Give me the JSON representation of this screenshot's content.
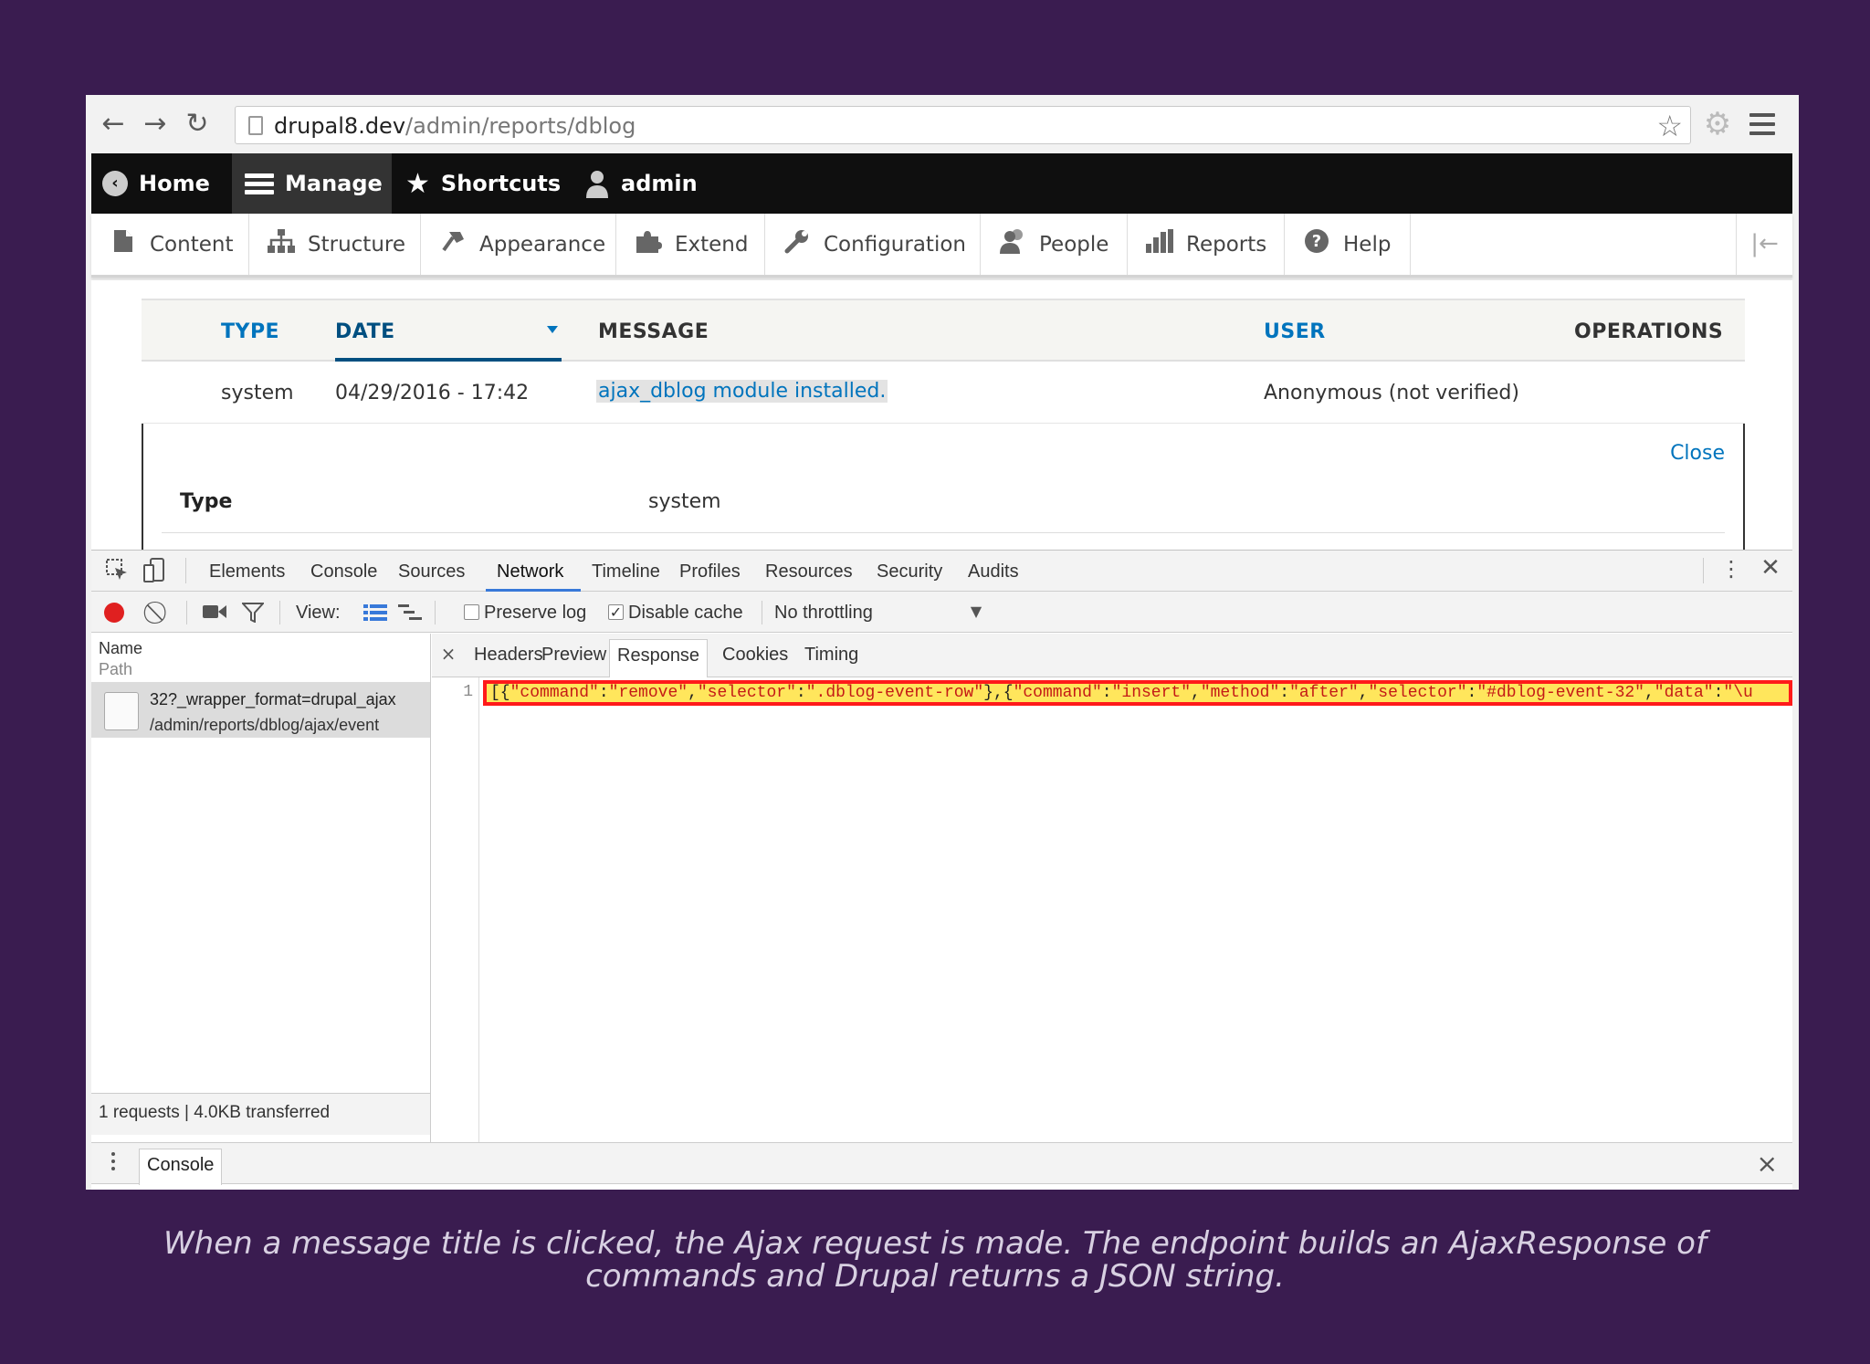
{
  "browser": {
    "url_host": "drupal8.dev",
    "url_path": "/admin/reports/dblog",
    "icons": {
      "back": "arrow-left",
      "forward": "arrow-right",
      "reload": "reload",
      "star": "star",
      "extension": "gear",
      "menu": "hamburger"
    }
  },
  "toolbar": {
    "home": "Home",
    "manage": "Manage",
    "shortcuts": "Shortcuts",
    "user": "admin",
    "tray": [
      "Content",
      "Structure",
      "Appearance",
      "Extend",
      "Configuration",
      "People",
      "Reports",
      "Help"
    ]
  },
  "dblog": {
    "headers": {
      "type": "TYPE",
      "date": "DATE",
      "message": "MESSAGE",
      "user": "USER",
      "operations": "OPERATIONS"
    },
    "row": {
      "type": "system",
      "date": "04/29/2016 - 17:42",
      "message": "ajax_dblog module installed.",
      "user": "Anonymous (not verified)"
    },
    "detail": {
      "close": "Close",
      "type_label": "Type",
      "type_value": "system"
    }
  },
  "devtools": {
    "tabs": [
      "Elements",
      "Console",
      "Sources",
      "Network",
      "Timeline",
      "Profiles",
      "Resources",
      "Security",
      "Audits"
    ],
    "active_tab": "Network",
    "network_toolbar": {
      "view_label": "View:",
      "preserve_log": "Preserve log",
      "preserve_log_checked": false,
      "disable_cache": "Disable cache",
      "disable_cache_checked": true,
      "throttling": "No throttling"
    },
    "requests_header": {
      "name": "Name",
      "path": "Path"
    },
    "request": {
      "name": "32?_wrapper_format=drupal_ajax",
      "path": "/admin/reports/dblog/ajax/event"
    },
    "status": "1 requests | 4.0KB transferred",
    "detail_tabs": [
      "Headers",
      "Preview",
      "Response",
      "Cookies",
      "Timing"
    ],
    "active_detail_tab": "Response",
    "response_line_number": "1",
    "response_json": "[{\"command\":\"remove\",\"selector\":\".dblog-event-row\"},{\"command\":\"insert\",\"method\":\"after\",\"selector\":\"#dblog-event-32\",\"data\":\"\\u",
    "drawer_tab": "Console"
  },
  "caption": "When a message title is clicked, the Ajax request is made. The endpoint builds an AjaxResponse of commands and Drupal returns a JSON string.",
  "colors": {
    "background": "#3a1c50",
    "drupal_link": "#0074bd",
    "highlight_border": "#ff1a1a",
    "highlight_fill": "#ffe65c"
  }
}
